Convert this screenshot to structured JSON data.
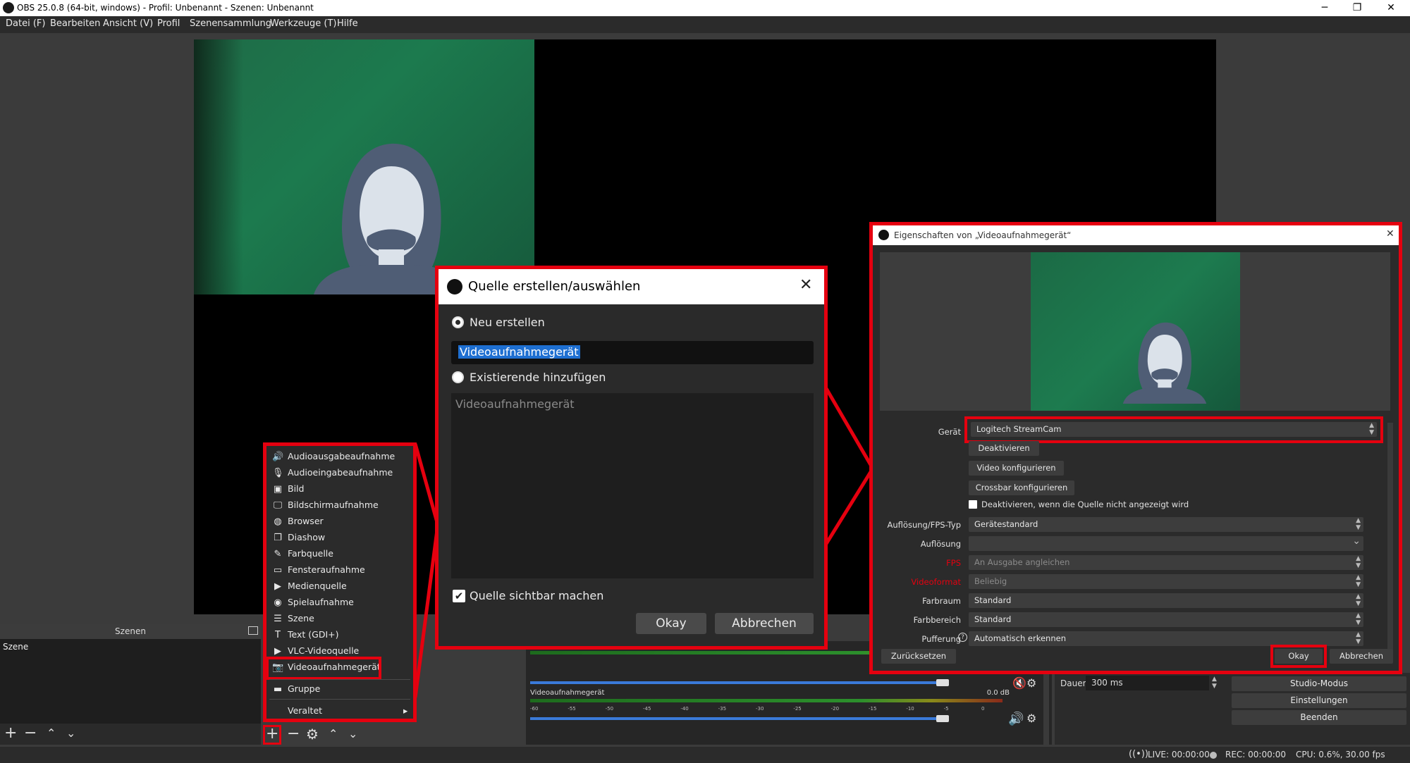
{
  "window": {
    "title": "OBS 25.0.8 (64-bit, windows) - Profil: Unbenannt - Szenen: Unbenannt",
    "minimize": "─",
    "restore": "❐",
    "close": "✕"
  },
  "menu": {
    "items": [
      {
        "label": "Datei (F)"
      },
      {
        "label": "Bearbeiten"
      },
      {
        "label": "Ansicht (V)"
      },
      {
        "label": "Profil"
      },
      {
        "label": "Szenensammlung"
      },
      {
        "label": "Werkzeuge (T)"
      },
      {
        "label": "Hilfe"
      }
    ]
  },
  "scenes": {
    "header": "Szenen",
    "items": [
      "Szene"
    ]
  },
  "source_menu": {
    "items": [
      {
        "icon": "speaker-icon",
        "glyph": "🔊",
        "label": "Audioausgabeaufnahme"
      },
      {
        "icon": "microphone-icon",
        "glyph": "🎙",
        "label": "Audioeingabeaufnahme"
      },
      {
        "icon": "image-icon",
        "glyph": "▣",
        "label": "Bild"
      },
      {
        "icon": "monitor-icon",
        "glyph": "🖵",
        "label": "Bildschirmaufnahme"
      },
      {
        "icon": "globe-icon",
        "glyph": "◍",
        "label": "Browser"
      },
      {
        "icon": "slideshow-icon",
        "glyph": "❐",
        "label": "Diashow"
      },
      {
        "icon": "brush-icon",
        "glyph": "✎",
        "label": "Farbquelle"
      },
      {
        "icon": "window-icon",
        "glyph": "▭",
        "label": "Fensteraufnahme"
      },
      {
        "icon": "play-icon",
        "glyph": "▶",
        "label": "Medienquelle"
      },
      {
        "icon": "gamepad-icon",
        "glyph": "◉",
        "label": "Spielaufnahme"
      },
      {
        "icon": "list-icon",
        "glyph": "☰",
        "label": "Szene"
      },
      {
        "icon": "text-icon",
        "glyph": "T",
        "label": "Text (GDI+)"
      },
      {
        "icon": "play-icon",
        "glyph": "▶",
        "label": "VLC-Videoquelle"
      },
      {
        "icon": "camera-icon",
        "glyph": "📷",
        "label": "Videoaufnahmegerät"
      }
    ],
    "group": {
      "icon": "folder-icon",
      "glyph": "▬",
      "label": "Gruppe"
    },
    "deprecated": {
      "label": "Veraltet",
      "arrow": "▸"
    }
  },
  "create_dialog": {
    "title": "Quelle erstellen/auswählen",
    "option_new": "Neu erstellen",
    "name_value": "Videoaufnahmegerät",
    "option_existing": "Existierende hinzufügen",
    "existing_placeholder": "Videoaufnahmegerät",
    "visible_checkbox": "Quelle sichtbar machen",
    "ok": "Okay",
    "cancel": "Abbrechen"
  },
  "props_dialog": {
    "title": "Eigenschaften von „Videoaufnahmegerät“",
    "device_label": "Gerät",
    "device_value": "Logitech StreamCam",
    "deactivate_btn": "Deaktivieren",
    "configure_video_btn": "Video konfigurieren",
    "configure_crossbar_btn": "Crossbar konfigurieren",
    "deactivate_hidden_checkbox": "Deaktivieren, wenn die Quelle nicht angezeigt wird",
    "fields": [
      {
        "label": "Auflösung/FPS-Typ",
        "value": "Gerätestandard",
        "dim": false,
        "label_color": "#e0e0e0",
        "control": "spin"
      },
      {
        "label": "Auflösung",
        "value": "",
        "dim": false,
        "label_color": "#e0e0e0",
        "control": "chevron"
      },
      {
        "label": "FPS",
        "value": "An Ausgabe angleichen",
        "dim": true,
        "label_color": "#e5000f",
        "control": "spin"
      },
      {
        "label": "Videoformat",
        "value": "Beliebig",
        "dim": true,
        "label_color": "#e5000f",
        "control": "spin"
      },
      {
        "label": "Farbraum",
        "value": "Standard",
        "dim": false,
        "label_color": "#e0e0e0",
        "control": "spin"
      },
      {
        "label": "Farbbereich",
        "value": "Standard",
        "dim": false,
        "label_color": "#e0e0e0",
        "control": "spin"
      },
      {
        "label": "Pufferung",
        "value": "Automatisch erkennen",
        "dim": false,
        "label_color": "#e0e0e0",
        "control": "spin"
      }
    ],
    "reset": "Zurücksetzen",
    "ok": "Okay",
    "cancel": "Abbrechen"
  },
  "mixer": {
    "channels": [
      {
        "name": "",
        "level": "",
        "volume": 0.86
      },
      {
        "name": "Videoaufnahmegerät",
        "level": "0.0 dB",
        "volume": 0.86
      }
    ],
    "scale": [
      "-60",
      "-55",
      "-50",
      "-45",
      "-40",
      "-35",
      "-30",
      "-25",
      "-20",
      "-15",
      "-10",
      "-5",
      "0"
    ]
  },
  "transitions": {
    "duration_label": "Dauer",
    "duration_value": "300 ms"
  },
  "controls": {
    "studio_mode": "Studio-Modus",
    "settings": "Einstellungen",
    "exit": "Beenden"
  },
  "status": {
    "live": "LIVE: 00:00:00",
    "rec": "REC: 00:00:00",
    "cpu": "CPU: 0.6%, 30.00 fps"
  },
  "colors": {
    "accent_red": "#e5000f",
    "selection_blue": "#1e6fd1",
    "chroma_green": "#1c7a4e"
  }
}
